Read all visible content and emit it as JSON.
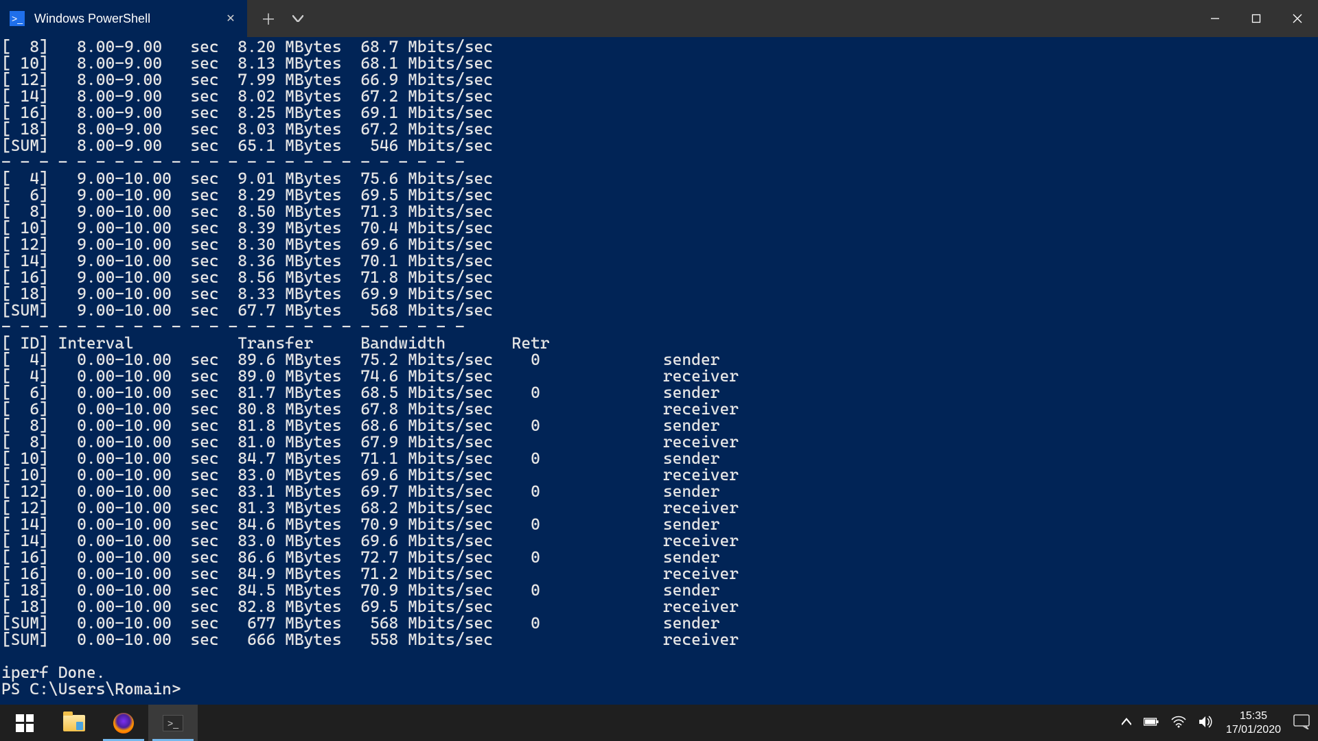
{
  "titlebar": {
    "tab_title": "Windows PowerShell"
  },
  "terminal": {
    "sep": "- - - - - - - - - - - - - - - - - - - - - - - - -",
    "block_8_9": [
      "[  8]   8.00-9.00   sec  8.20 MBytes  68.7 Mbits/sec",
      "[ 10]   8.00-9.00   sec  8.13 MBytes  68.1 Mbits/sec",
      "[ 12]   8.00-9.00   sec  7.99 MBytes  66.9 Mbits/sec",
      "[ 14]   8.00-9.00   sec  8.02 MBytes  67.2 Mbits/sec",
      "[ 16]   8.00-9.00   sec  8.25 MBytes  69.1 Mbits/sec",
      "[ 18]   8.00-9.00   sec  8.03 MBytes  67.2 Mbits/sec",
      "[SUM]   8.00-9.00   sec  65.1 MBytes   546 Mbits/sec"
    ],
    "block_9_10": [
      "[  4]   9.00-10.00  sec  9.01 MBytes  75.6 Mbits/sec",
      "[  6]   9.00-10.00  sec  8.29 MBytes  69.5 Mbits/sec",
      "[  8]   9.00-10.00  sec  8.50 MBytes  71.3 Mbits/sec",
      "[ 10]   9.00-10.00  sec  8.39 MBytes  70.4 Mbits/sec",
      "[ 12]   9.00-10.00  sec  8.30 MBytes  69.6 Mbits/sec",
      "[ 14]   9.00-10.00  sec  8.36 MBytes  70.1 Mbits/sec",
      "[ 16]   9.00-10.00  sec  8.56 MBytes  71.8 Mbits/sec",
      "[ 18]   9.00-10.00  sec  8.33 MBytes  69.9 Mbits/sec",
      "[SUM]   9.00-10.00  sec  67.7 MBytes   568 Mbits/sec"
    ],
    "summary_header": "[ ID] Interval           Transfer     Bandwidth       Retr",
    "summary": [
      "[  4]   0.00-10.00  sec  89.6 MBytes  75.2 Mbits/sec    0             sender",
      "[  4]   0.00-10.00  sec  89.0 MBytes  74.6 Mbits/sec                  receiver",
      "[  6]   0.00-10.00  sec  81.7 MBytes  68.5 Mbits/sec    0             sender",
      "[  6]   0.00-10.00  sec  80.8 MBytes  67.8 Mbits/sec                  receiver",
      "[  8]   0.00-10.00  sec  81.8 MBytes  68.6 Mbits/sec    0             sender",
      "[  8]   0.00-10.00  sec  81.0 MBytes  67.9 Mbits/sec                  receiver",
      "[ 10]   0.00-10.00  sec  84.7 MBytes  71.1 Mbits/sec    0             sender",
      "[ 10]   0.00-10.00  sec  83.0 MBytes  69.6 Mbits/sec                  receiver",
      "[ 12]   0.00-10.00  sec  83.1 MBytes  69.7 Mbits/sec    0             sender",
      "[ 12]   0.00-10.00  sec  81.3 MBytes  68.2 Mbits/sec                  receiver",
      "[ 14]   0.00-10.00  sec  84.6 MBytes  70.9 Mbits/sec    0             sender",
      "[ 14]   0.00-10.00  sec  83.0 MBytes  69.6 Mbits/sec                  receiver",
      "[ 16]   0.00-10.00  sec  86.6 MBytes  72.7 Mbits/sec    0             sender",
      "[ 16]   0.00-10.00  sec  84.9 MBytes  71.2 Mbits/sec                  receiver",
      "[ 18]   0.00-10.00  sec  84.5 MBytes  70.9 Mbits/sec    0             sender",
      "[ 18]   0.00-10.00  sec  82.8 MBytes  69.5 Mbits/sec                  receiver",
      "[SUM]   0.00-10.00  sec   677 MBytes   568 Mbits/sec    0             sender",
      "[SUM]   0.00-10.00  sec   666 MBytes   558 Mbits/sec                  receiver"
    ],
    "done": "iperf Done.",
    "prompt": "PS C:\\Users\\Romain>"
  },
  "taskbar": {
    "time": "15:35",
    "date": "17/01/2020"
  }
}
